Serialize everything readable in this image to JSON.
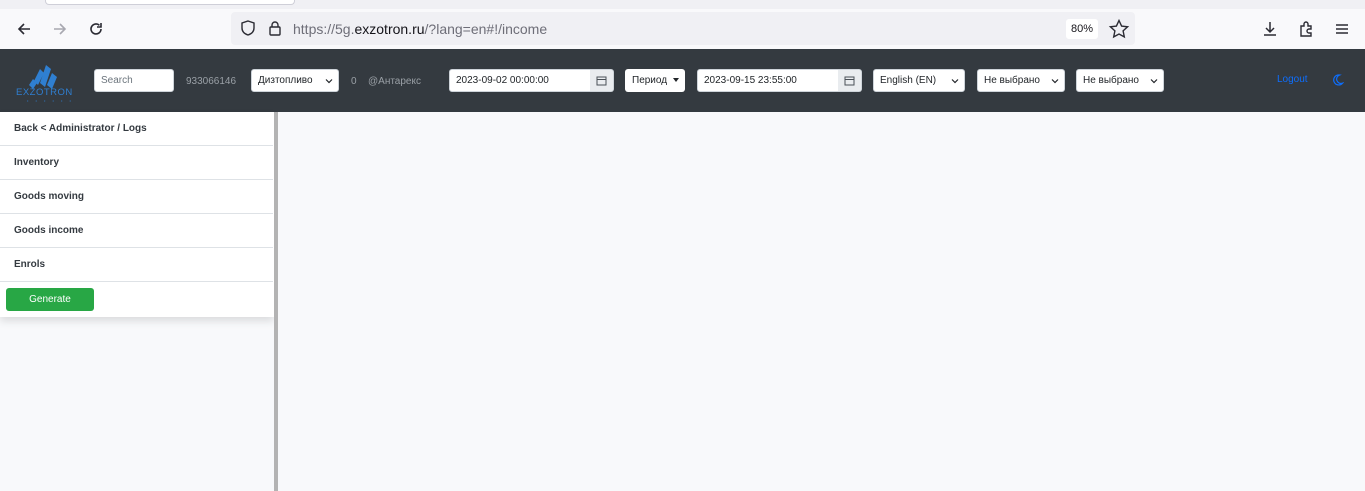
{
  "browser": {
    "url_prefix": "https://5g.",
    "url_domain": "exzotron.ru",
    "url_suffix": "/?lang=en#!/income",
    "zoom": "80%"
  },
  "header": {
    "logo_text": "EXZOTRON",
    "search_placeholder": "Search",
    "phone": "933066146",
    "fuel_select": "Дизтопливо",
    "count": "0",
    "company": "@Антарекс",
    "date_from": "2023-09-02 00:00:00",
    "period_label": "Период",
    "date_to": "2023-09-15 23:55:00",
    "language": "English (EN)",
    "filter1": "Не выбрано",
    "filter2": "Не выбрано",
    "logout": "Logout"
  },
  "sidebar": {
    "items": [
      {
        "label": "Back < Administrator / Logs"
      },
      {
        "label": "Inventory"
      },
      {
        "label": "Goods moving"
      },
      {
        "label": "Goods income"
      },
      {
        "label": "Enrols"
      }
    ],
    "generate_label": "Generate"
  },
  "colors": {
    "header_bg": "#343a40",
    "accent": "#0d6efd",
    "generate": "#28a745"
  }
}
